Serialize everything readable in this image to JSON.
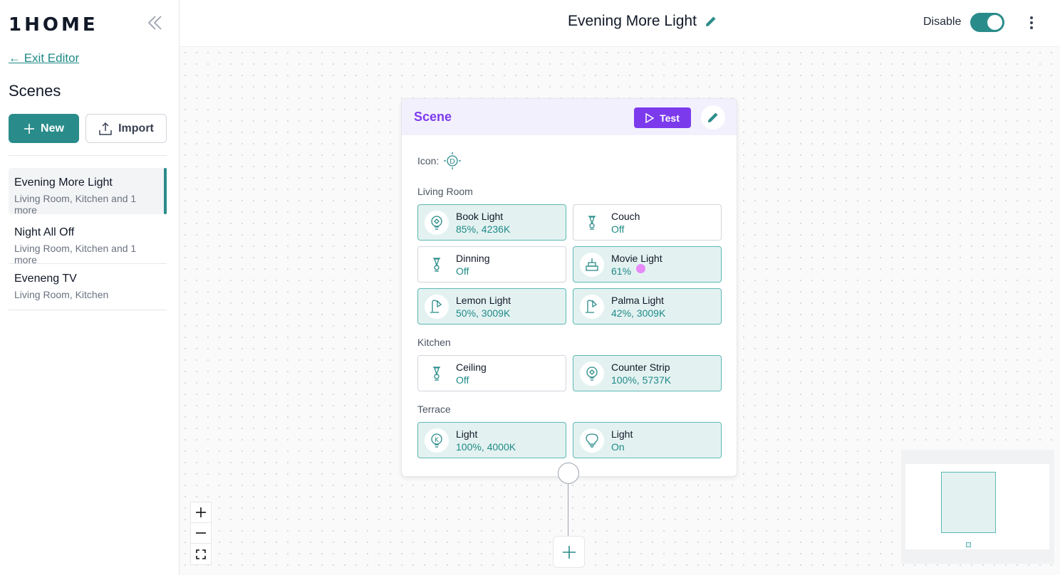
{
  "app": {
    "logo": "1HOME",
    "exit_label": "← Exit Editor"
  },
  "sidebar": {
    "title": "Scenes",
    "new_label": "New",
    "import_label": "Import",
    "scenes": [
      {
        "name": "Evening More Light",
        "rooms": "Living Room, Kitchen and 1 more",
        "active": true
      },
      {
        "name": "Night All Off",
        "rooms": "Living Room, Kitchen and 1 more",
        "active": false
      },
      {
        "name": "Eveneng TV",
        "rooms": "Living Room, Kitchen",
        "active": false
      }
    ]
  },
  "header": {
    "title": "Evening More Light",
    "disable_label": "Disable",
    "toggle_on": true
  },
  "card": {
    "title": "Scene",
    "test_label": "Test",
    "icon_label": "Icon:",
    "groups": [
      {
        "name": "Living Room",
        "devices": [
          {
            "name": "Book Light",
            "state": "85%, 4236K",
            "on": true,
            "icon": "bulb-icon"
          },
          {
            "name": "Couch",
            "state": "Off",
            "on": false,
            "icon": "pendant-lamp-icon"
          },
          {
            "name": "Dinning",
            "state": "Off",
            "on": false,
            "icon": "pendant-lamp-icon"
          },
          {
            "name": "Movie Light",
            "state": "61%",
            "on": true,
            "icon": "table-lamp-icon"
          },
          {
            "name": "Lemon Light",
            "state": "50%, 3009K",
            "on": true,
            "icon": "desk-lamp-icon"
          },
          {
            "name": "Palma Light",
            "state": "42%, 3009K",
            "on": true,
            "icon": "desk-lamp-icon"
          }
        ]
      },
      {
        "name": "Kitchen",
        "devices": [
          {
            "name": "Ceiling",
            "state": "Off",
            "on": false,
            "icon": "pendant-lamp-icon"
          },
          {
            "name": "Counter Strip",
            "state": "100%, 5737K",
            "on": true,
            "icon": "bulb-icon"
          }
        ]
      },
      {
        "name": "Terrace",
        "devices": [
          {
            "name": "Light",
            "state": "100%, 4000K",
            "on": true,
            "icon": "k-bulb-icon"
          },
          {
            "name": "Light",
            "state": "On",
            "on": true,
            "icon": "bulb-outline-icon"
          }
        ]
      }
    ]
  },
  "colors": {
    "accent": "#2a8c8a",
    "purple": "#7c3aed",
    "device_on_bg": "#e3f2f1"
  }
}
